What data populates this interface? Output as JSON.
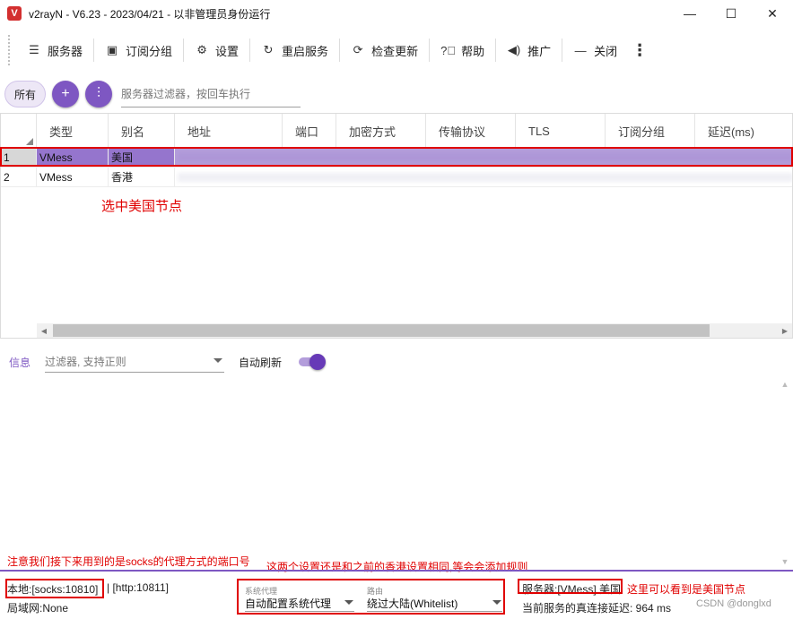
{
  "window": {
    "title": "v2rayN - V6.23 - 2023/04/21 - 以非管理员身份运行",
    "app_icon": "V",
    "controls": {
      "minimize": "—",
      "maximize": "☐",
      "close": "✕"
    }
  },
  "toolbar": {
    "items": [
      {
        "label": "服务器",
        "icon": "server-icon"
      },
      {
        "label": "订阅分组",
        "icon": "subscription-icon"
      },
      {
        "label": "设置",
        "icon": "gear-icon"
      },
      {
        "label": "重启服务",
        "icon": "restart-icon"
      },
      {
        "label": "检查更新",
        "icon": "update-icon"
      },
      {
        "label": "帮助",
        "icon": "help-icon"
      },
      {
        "label": "推广",
        "icon": "speaker-icon"
      },
      {
        "label": "关闭",
        "icon": "minus-icon"
      }
    ],
    "more": "⋮"
  },
  "filter": {
    "all_label": "所有",
    "placeholder": "服务器过滤器，按回车执行"
  },
  "table": {
    "headers": [
      "",
      "类型",
      "别名",
      "地址",
      "端口",
      "加密方式",
      "传输协议",
      "TLS",
      "订阅分组",
      "延迟(ms)"
    ],
    "rows": [
      {
        "index": "1",
        "type": "VMess",
        "alias": "美国",
        "selected": true
      },
      {
        "index": "2",
        "type": "VMess",
        "alias": "香港",
        "selected": false
      }
    ]
  },
  "annotations": {
    "select_us": "选中美国节点",
    "socks_port_note": "注意我们接下来用到的是socks的代理方式的端口号",
    "settings_note": "这两个设置还是和之前的香港设置相同,等会会添加规则",
    "server_note": "这里可以看到是美国节点"
  },
  "log": {
    "tab_label": "信息",
    "filter_placeholder": "过滤器, 支持正则",
    "auto_refresh_label": "自动刷新",
    "auto_refresh_on": true
  },
  "status": {
    "local": "本地:[socks:10810]",
    "http": "| [http:10811]",
    "lan": "局域网:None",
    "sysproxy_label": "系统代理",
    "sysproxy_value": "自动配置系统代理",
    "routing_label": "路由",
    "routing_value": "绕过大陆(Whitelist)",
    "server": "服务器:[VMess] 美国",
    "latency": "当前服务的真连接延迟: 964 ms"
  },
  "watermark": "CSDN @donglxd",
  "colors": {
    "accent": "#7e57c2",
    "annotation": "#e00000",
    "selected_row": "#b39ddb"
  }
}
